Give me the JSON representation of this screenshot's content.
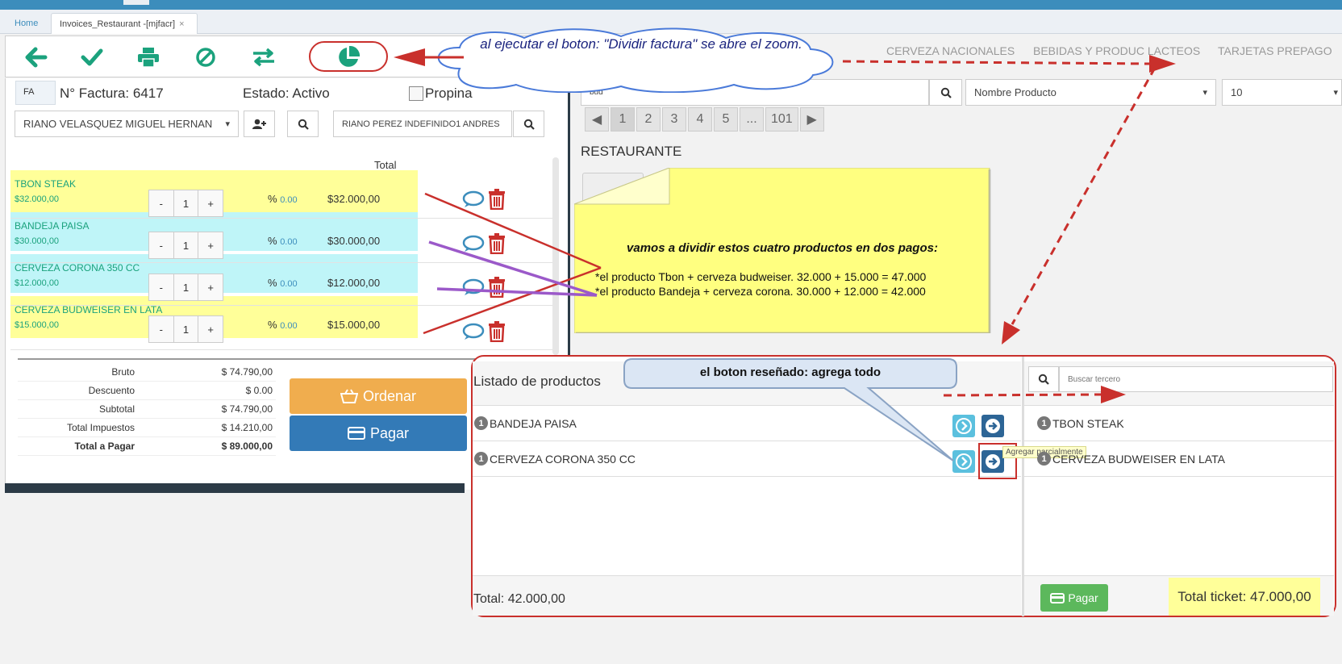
{
  "tabs": {
    "home": "Home",
    "invoice": "Invoices_Restaurant -[mjfacr]",
    "close": "×"
  },
  "toolbar": {
    "back_icon": "arrow-left-icon",
    "confirm_icon": "check-icon",
    "print_icon": "printer-icon",
    "cancel_icon": "ban-icon",
    "transfer_icon": "exchange-icon",
    "split_icon": "pie-chart-icon"
  },
  "invoice": {
    "doc_type": "FA",
    "number": "N° Factura: 6417",
    "status": "Estado: Activo",
    "tip_label": "Propina",
    "client": "RIANO VELASQUEZ MIGUEL HERNAN",
    "client_caret": "▾",
    "waiter": "RIANO PEREZ  INDEFINIDO1 ANDRES",
    "col_total": "Total"
  },
  "items": [
    {
      "name": "TBON STEAK",
      "price": "$32.000,00",
      "qty": "1",
      "pct": "%",
      "discount": "0.00",
      "total": "$32.000,00",
      "color": "#ffff99"
    },
    {
      "name": "BANDEJA PAISA",
      "price": "$30.000,00",
      "qty": "1",
      "pct": "%",
      "discount": "0.00",
      "total": "$30.000,00",
      "color": "#bff5f8"
    },
    {
      "name": "CERVEZA CORONA 350 CC",
      "price": "$12.000,00",
      "qty": "1",
      "pct": "%",
      "discount": "0.00",
      "total": "$12.000,00",
      "color": "#bff5f8"
    },
    {
      "name": "CERVEZA BUDWEISER EN LATA",
      "price": "$15.000,00",
      "qty": "1",
      "pct": "%",
      "discount": "0.00",
      "total": "$15.000,00",
      "color": "#ffff99"
    }
  ],
  "qty_buttons": {
    "minus": "-",
    "plus": "+"
  },
  "totals": [
    {
      "label": "Bruto",
      "value": "$ 74.790,00"
    },
    {
      "label": "Descuento",
      "value": "$ 0.00"
    },
    {
      "label": "Subtotal",
      "value": "$ 74.790,00"
    },
    {
      "label": "Total Impuestos",
      "value": "$ 14.210,00"
    },
    {
      "label": "Total a Pagar",
      "value": "$ 89.000,00"
    }
  ],
  "actions": {
    "order": "Ordenar",
    "pay": "Pagar"
  },
  "catalog": {
    "categories": [
      "CERVEZA NACIONALES",
      "BEBIDAS Y PRODUC LACTEOS",
      "TARJETAS PREPAGO"
    ],
    "search_value": "bud",
    "order_by": "Nombre Producto",
    "page_size": "10",
    "pages": [
      "◀",
      "1",
      "2",
      "3",
      "4",
      "5",
      "...",
      "101",
      "▶"
    ],
    "active_page": "1",
    "section": "RESTAURANTE"
  },
  "annotations": {
    "cloud": "al ejecutar el boton: \"Dividir factura\" se abre el zoom.",
    "note_title": "vamos a dividir estos cuatro productos en dos pagos:",
    "note_line1": "*el producto Tbon + cerveza budweiser. 32.000 + 15.000 = 47.000",
    "note_line2": "*el producto Bandeja + cerveza corona. 30.000 + 12.000 = 42.000",
    "bubble": "el boton reseñado: agrega todo"
  },
  "split_modal": {
    "left_title": "Listado de productos",
    "left_items": [
      {
        "qty": "1",
        "name": "BANDEJA PAISA"
      },
      {
        "qty": "1",
        "name": "CERVEZA CORONA 350 CC"
      }
    ],
    "left_total": "Total: 42.000,00",
    "search_placeholder": "Buscar tercero",
    "right_items": [
      {
        "qty": "1",
        "name": "TBON STEAK"
      },
      {
        "qty": "1",
        "name": "CERVEZA BUDWEISER EN LATA"
      }
    ],
    "tooltip": "Agregar parcialmente",
    "pay": "Pagar",
    "ticket_total": "Total ticket: 47.000,00"
  },
  "colors": {
    "accent": "#3c8dbc",
    "green": "#1ba27d",
    "annotation_red": "#c9302c",
    "annotation_purple": "#9b59c9"
  }
}
